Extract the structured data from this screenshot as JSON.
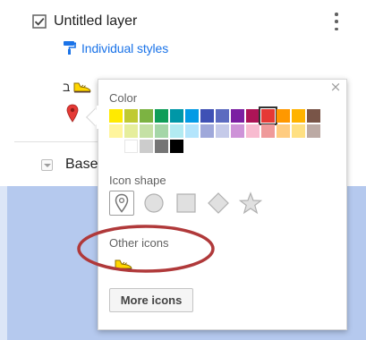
{
  "layer": {
    "title": "Untitled layer",
    "checked": true,
    "styles_link": "Individual styles",
    "feature_label": "ב"
  },
  "base_map": {
    "label_partial": "Base"
  },
  "style_popup": {
    "close_glyph": "×",
    "color_label": "Color",
    "icon_shape_label": "Icon shape",
    "other_icons_label": "Other icons",
    "more_icons_label": "More icons",
    "selected_color": "#e53935",
    "selected_shape": "pin",
    "colors": [
      [
        "#ffea00",
        "#c0ca33",
        "#7cb342",
        "#0f9d58",
        "#0097a7",
        "#039be5",
        "#3f51b5",
        "#5c6bc0",
        "#7b1fa2",
        "#ad1457",
        "#e53935",
        "#ff9800",
        "#ffb300",
        "#795548"
      ],
      [
        "#fff59d",
        "#e6ee9c",
        "#c5e1a5",
        "#a5d6a7",
        "#b2ebf2",
        "#b3e5fc",
        "#9fa8da",
        "#c5cae9",
        "#ce93d8",
        "#f8bbd0",
        "#ef9a9a",
        "#ffcc80",
        "#ffe082",
        "#bcaaa4"
      ],
      [
        "#ffffff",
        "#cccccc",
        "#757575",
        "#000000"
      ]
    ],
    "shapes": [
      "pin",
      "circle",
      "square",
      "diamond",
      "star"
    ]
  },
  "colors": {
    "link_blue": "#1a73e8",
    "annotation_red": "#b0393a",
    "map_blue": "#b5c9ee"
  }
}
